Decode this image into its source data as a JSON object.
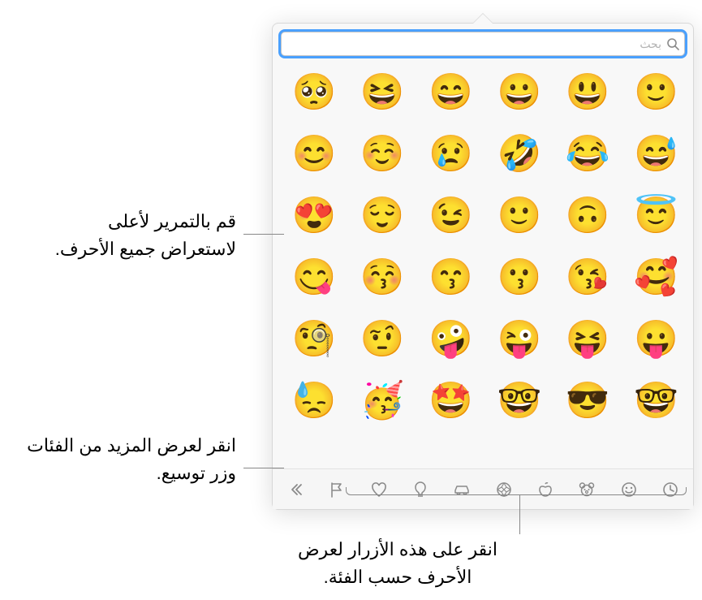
{
  "search": {
    "placeholder": "بحث",
    "value": ""
  },
  "emojis": [
    "🙂",
    "😃",
    "😀",
    "😄",
    "😆",
    "🥺",
    "😅",
    "😂",
    "🤣",
    "😢",
    "☺️",
    "😊",
    "😇",
    "🙃",
    "🙂",
    "😉",
    "😌",
    "😍",
    "🥰",
    "😘",
    "😗",
    "😙",
    "😚",
    "😋",
    "😛",
    "😝",
    "😜",
    "🤪",
    "🤨",
    "🧐",
    "🤓",
    "😎",
    "🤓",
    "🤩",
    "🥳",
    "😓"
  ],
  "category_icons": [
    "expand",
    "flag",
    "heart",
    "bulb",
    "car",
    "soccer",
    "apple",
    "bear",
    "smiley",
    "clock"
  ],
  "callouts": {
    "scroll": "قم بالتمرير لأعلى لاستعراض جميع الأحرف.",
    "expand": "انقر لعرض المزيد من الفئات وزر توسيع.",
    "categories": "انقر على هذه الأزرار لعرض الأحرف حسب الفئة."
  }
}
